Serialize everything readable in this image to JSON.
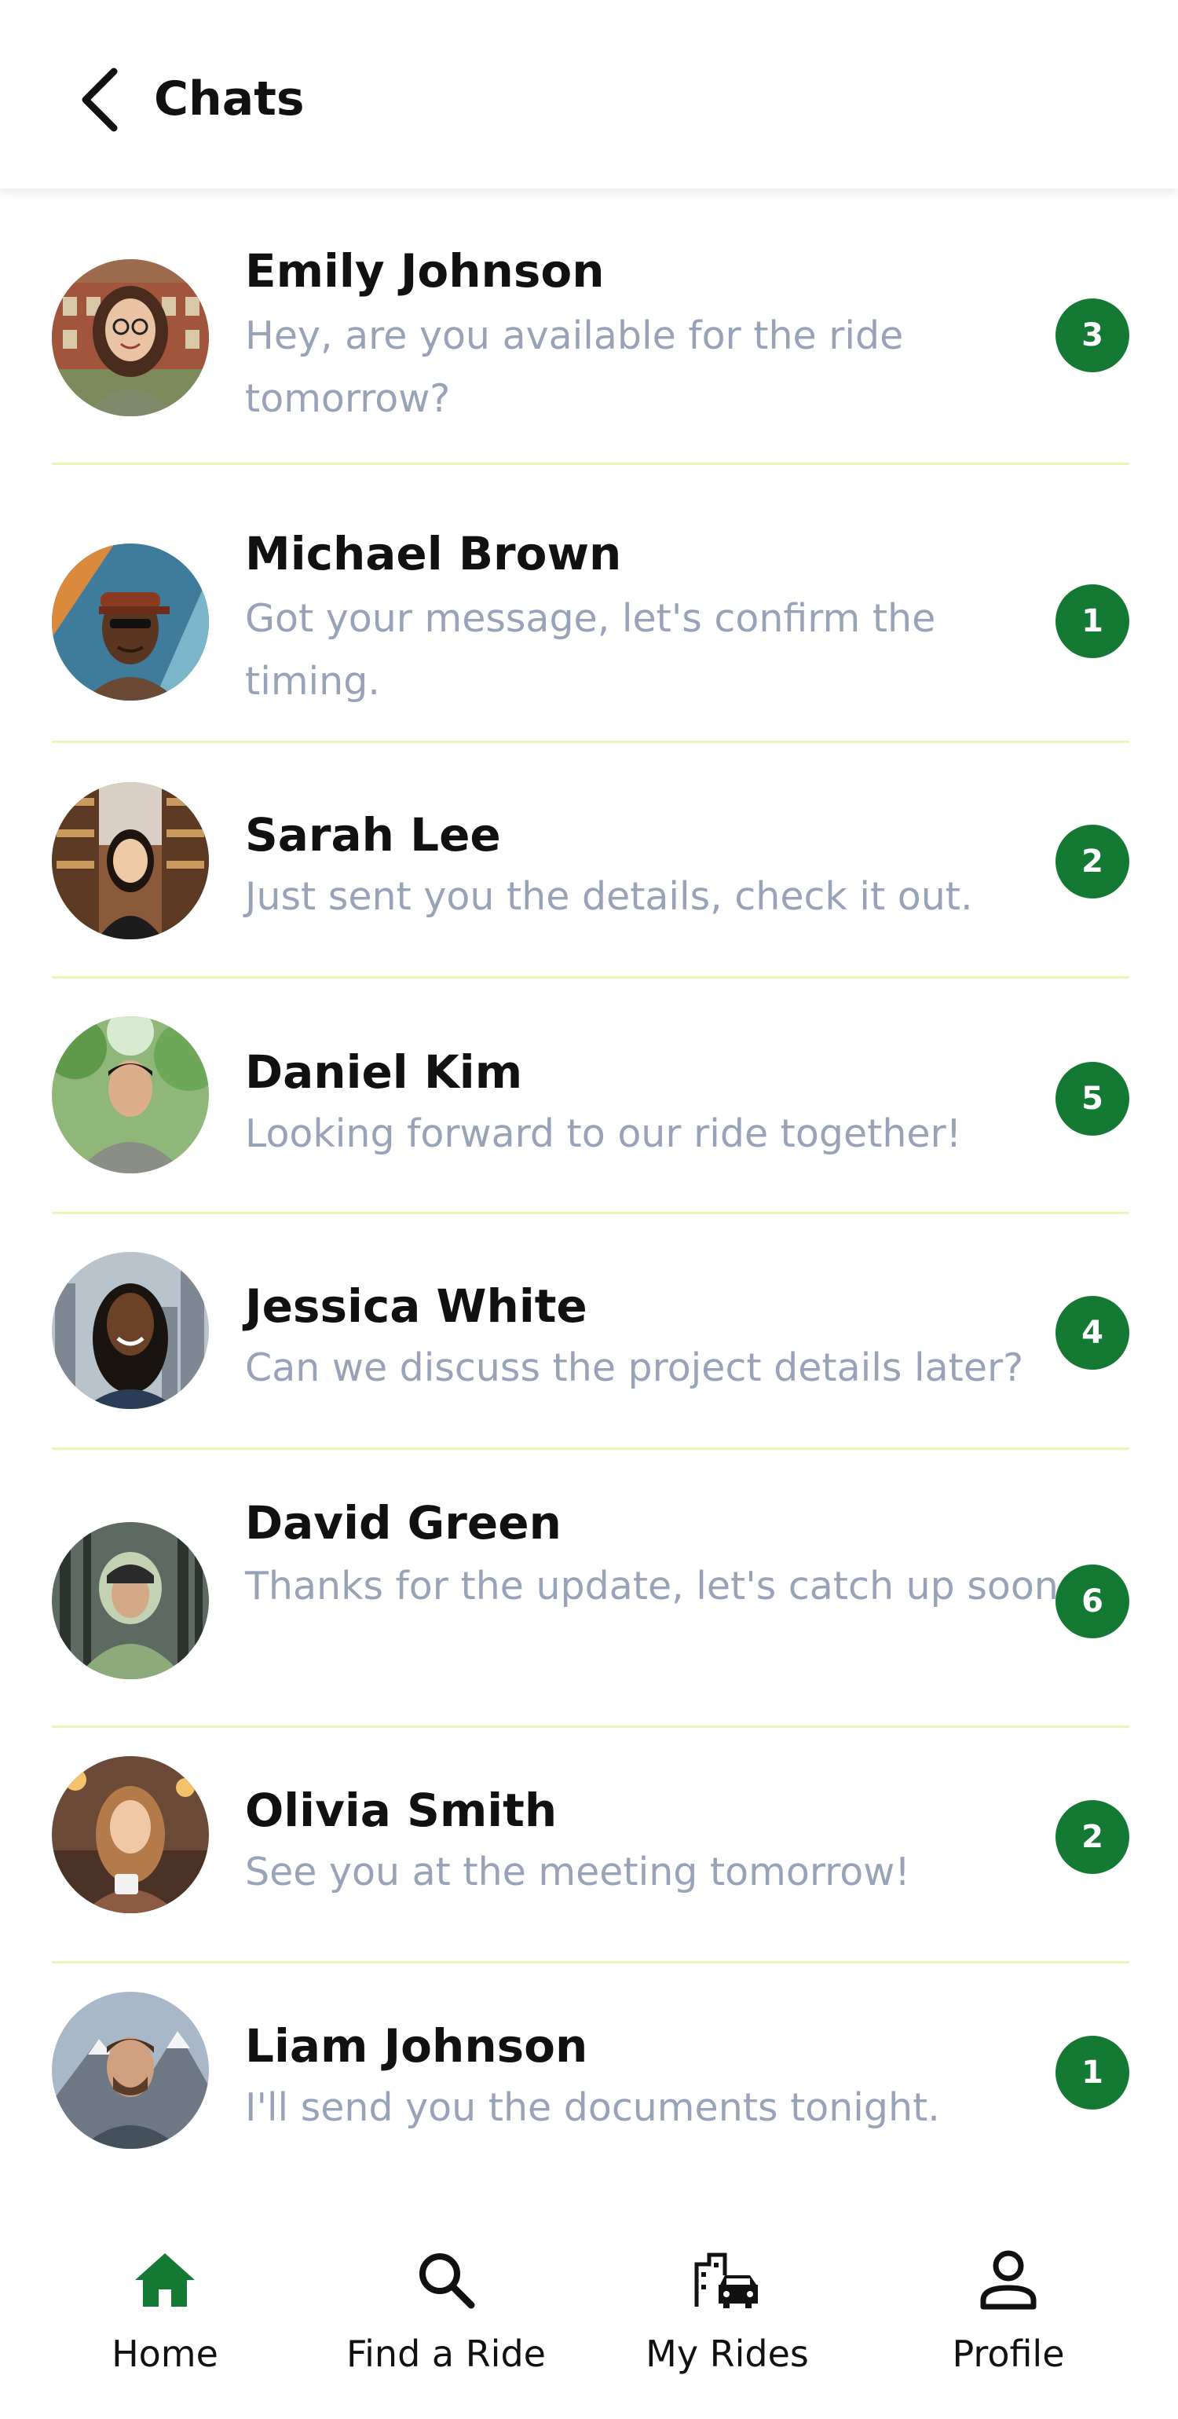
{
  "header": {
    "title": "Chats"
  },
  "colors": {
    "accent": "#147a33",
    "muted_text": "#98a3b8",
    "divider": "#eef3b8"
  },
  "chats": [
    {
      "name": "Emily Johnson",
      "message": "Hey, are you available for the ride tomorrow?",
      "unread": "3"
    },
    {
      "name": "Michael Brown",
      "message": "Got your message, let's confirm the timing.",
      "unread": "1"
    },
    {
      "name": "Sarah Lee",
      "message": "Just sent you the details, check it out.",
      "unread": "2"
    },
    {
      "name": "Daniel Kim",
      "message": "Looking forward to our ride together!",
      "unread": "5"
    },
    {
      "name": "Jessica White",
      "message": "Can we discuss the project details later?",
      "unread": "4"
    },
    {
      "name": "David Green",
      "message": "Thanks for the update, let's catch up soon.",
      "unread": "6"
    },
    {
      "name": "Olivia Smith",
      "message": "See you at the meeting tomorrow!",
      "unread": "2"
    },
    {
      "name": "Liam Johnson",
      "message": "I'll send you the documents tonight.",
      "unread": "1"
    }
  ],
  "nav": {
    "home": {
      "label": "Home",
      "icon": "home-icon",
      "active": true
    },
    "find_ride": {
      "label": "Find a Ride",
      "icon": "search-icon"
    },
    "my_rides": {
      "label": "My Rides",
      "icon": "car-city-icon"
    },
    "profile": {
      "label": "Profile",
      "icon": "person-icon"
    }
  }
}
